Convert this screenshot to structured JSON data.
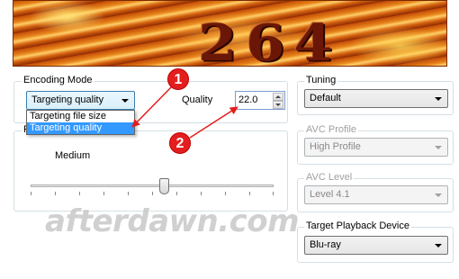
{
  "banner": {
    "text": "264"
  },
  "encoding_mode": {
    "label": "Encoding Mode",
    "selected": "Targeting quality",
    "options": [
      "Targeting file size",
      "Targeting quality"
    ],
    "quality_label": "Quality",
    "quality_value": "22.0"
  },
  "rate_group": {
    "label_fragment": "F",
    "level_label": "Medium"
  },
  "tuning": {
    "label": "Tuning",
    "value": "Default"
  },
  "avc_profile": {
    "label": "AVC Profile",
    "value": "High Profile"
  },
  "avc_level": {
    "label": "AVC Level",
    "value": "Level 4.1"
  },
  "playback": {
    "label": "Target Playback Device",
    "value": "Blu-ray"
  },
  "annotations": {
    "marker1": "1",
    "marker2": "2",
    "color": "#e41e1e"
  },
  "watermark": {
    "text": "afterdawn.com"
  }
}
